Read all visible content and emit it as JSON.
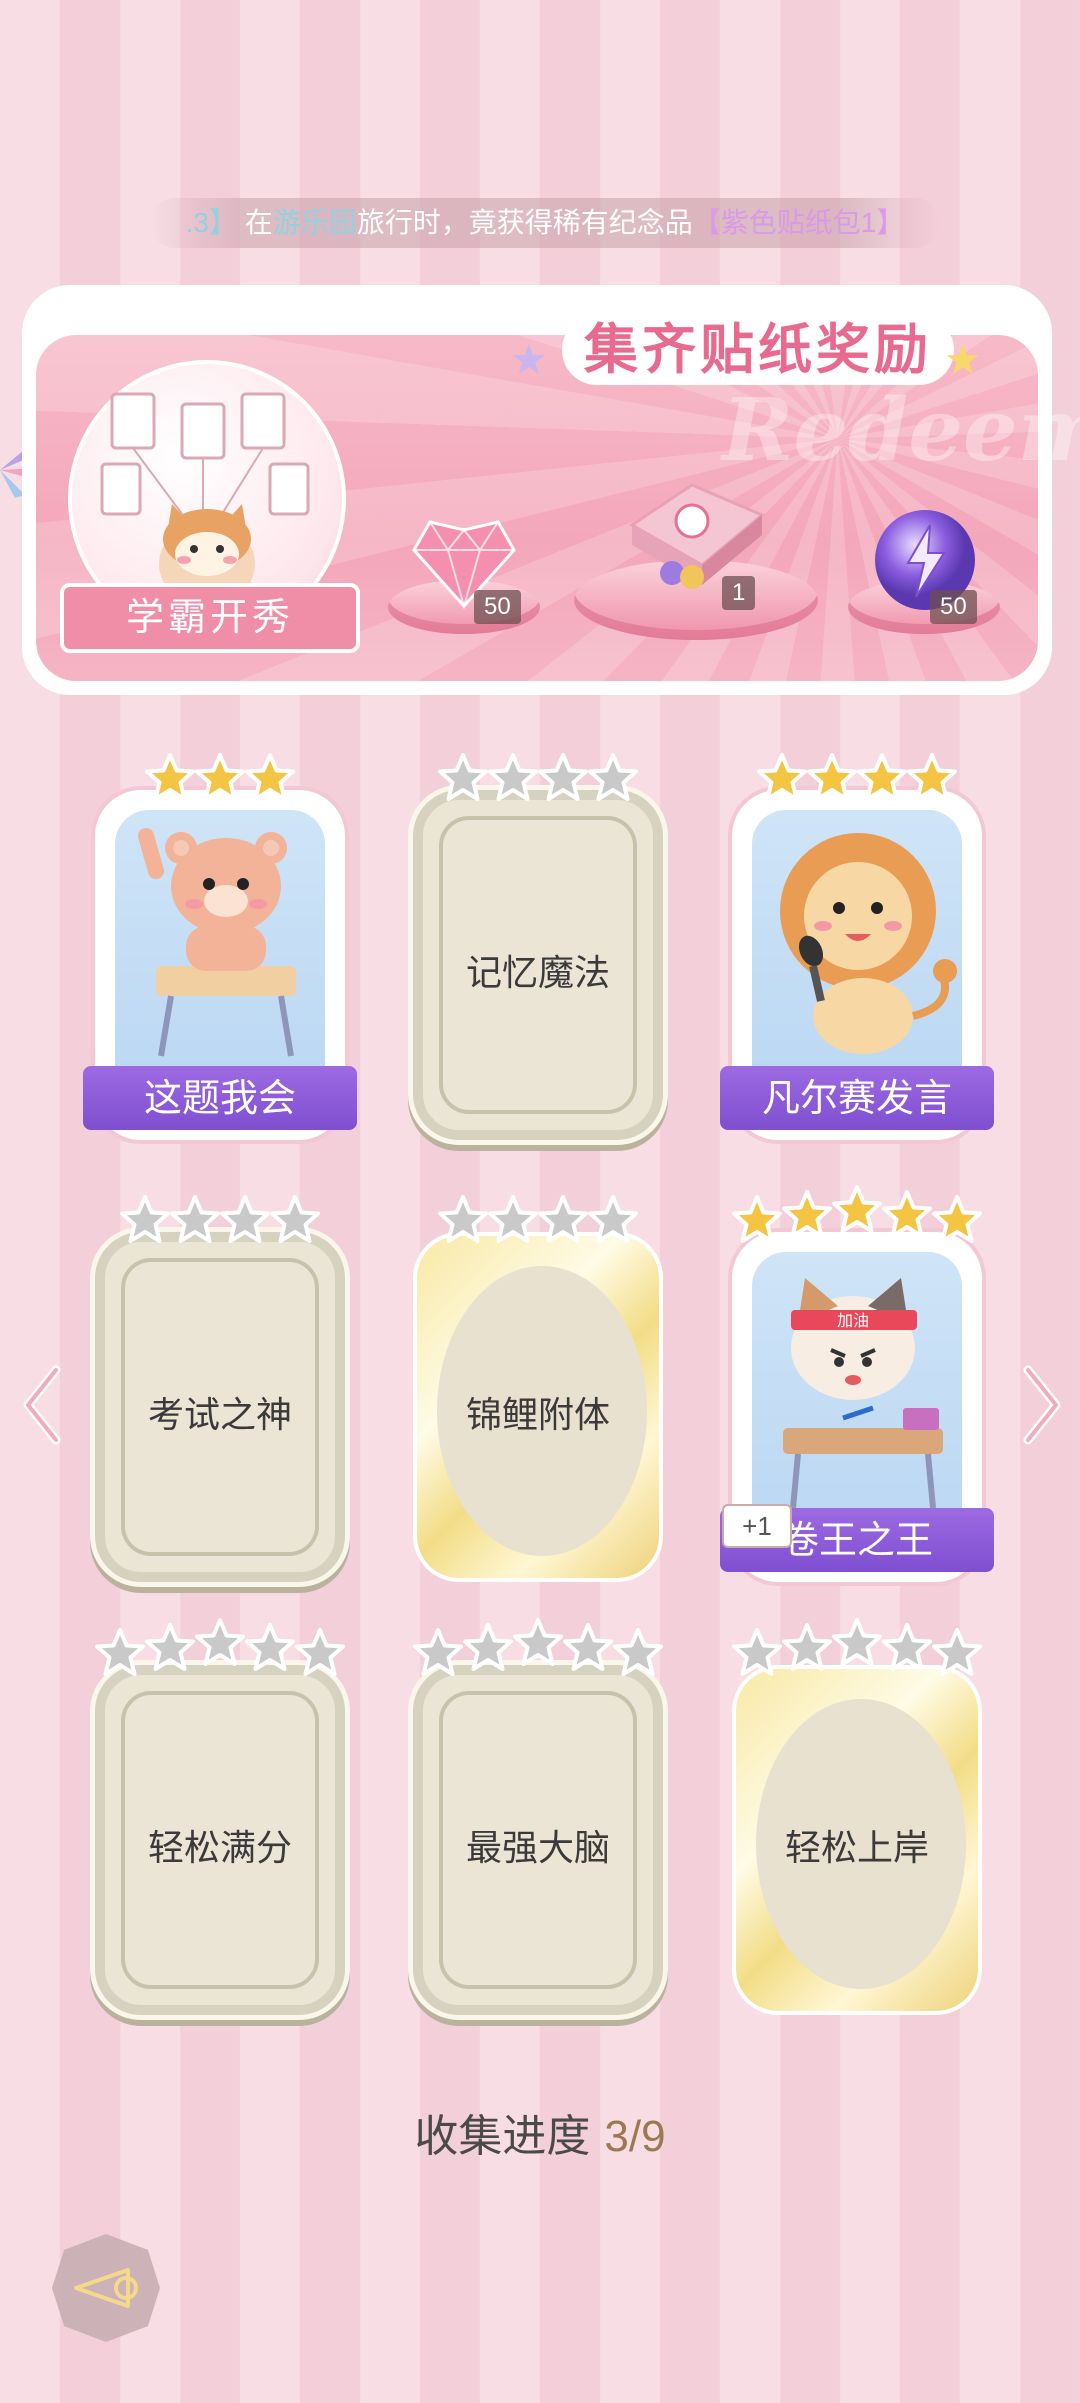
{
  "ticker": {
    "prefix": ".3】",
    "text_1": "在",
    "place": "游乐园",
    "text_2": "旅行时，竟获得稀有纪念品",
    "item": "【紫色贴纸包1】"
  },
  "banner": {
    "title": "集齐贴纸奖励",
    "watermark": "Redeem",
    "sticker_set_name": "学霸开秀",
    "rewards": [
      {
        "icon": "pink-diamond-icon",
        "count": "50"
      },
      {
        "icon": "gift-box-icon",
        "count": "1"
      },
      {
        "icon": "purple-energy-orb-icon",
        "count": "50"
      }
    ]
  },
  "cards": [
    {
      "label": "这题我会",
      "state": "owned",
      "stars": 3,
      "art": "bear-at-desk"
    },
    {
      "label": "记忆魔法",
      "state": "locked",
      "stars": 4
    },
    {
      "label": "凡尔赛发言",
      "state": "owned",
      "stars": 4,
      "art": "lion-with-microphone"
    },
    {
      "label": "考试之神",
      "state": "locked",
      "stars": 4
    },
    {
      "label": "锦鲤附体",
      "state": "locked-gold",
      "stars": 4
    },
    {
      "label": "卷王之王",
      "state": "owned",
      "stars": 5,
      "art": "cat-studying",
      "extra": "+1",
      "headband": "加油"
    },
    {
      "label": "轻松满分",
      "state": "locked",
      "stars": 5
    },
    {
      "label": "最强大脑",
      "state": "locked",
      "stars": 5
    },
    {
      "label": "轻松上岸",
      "state": "locked-gold",
      "stars": 5
    }
  ],
  "progress": {
    "label": "收集进度",
    "value": "3/9"
  },
  "colors": {
    "accent_pink": "#e96a8f",
    "ribbon_purple": "#8a5ad8",
    "star_gold": "#f4c443",
    "star_grey": "#c9c9c9"
  }
}
